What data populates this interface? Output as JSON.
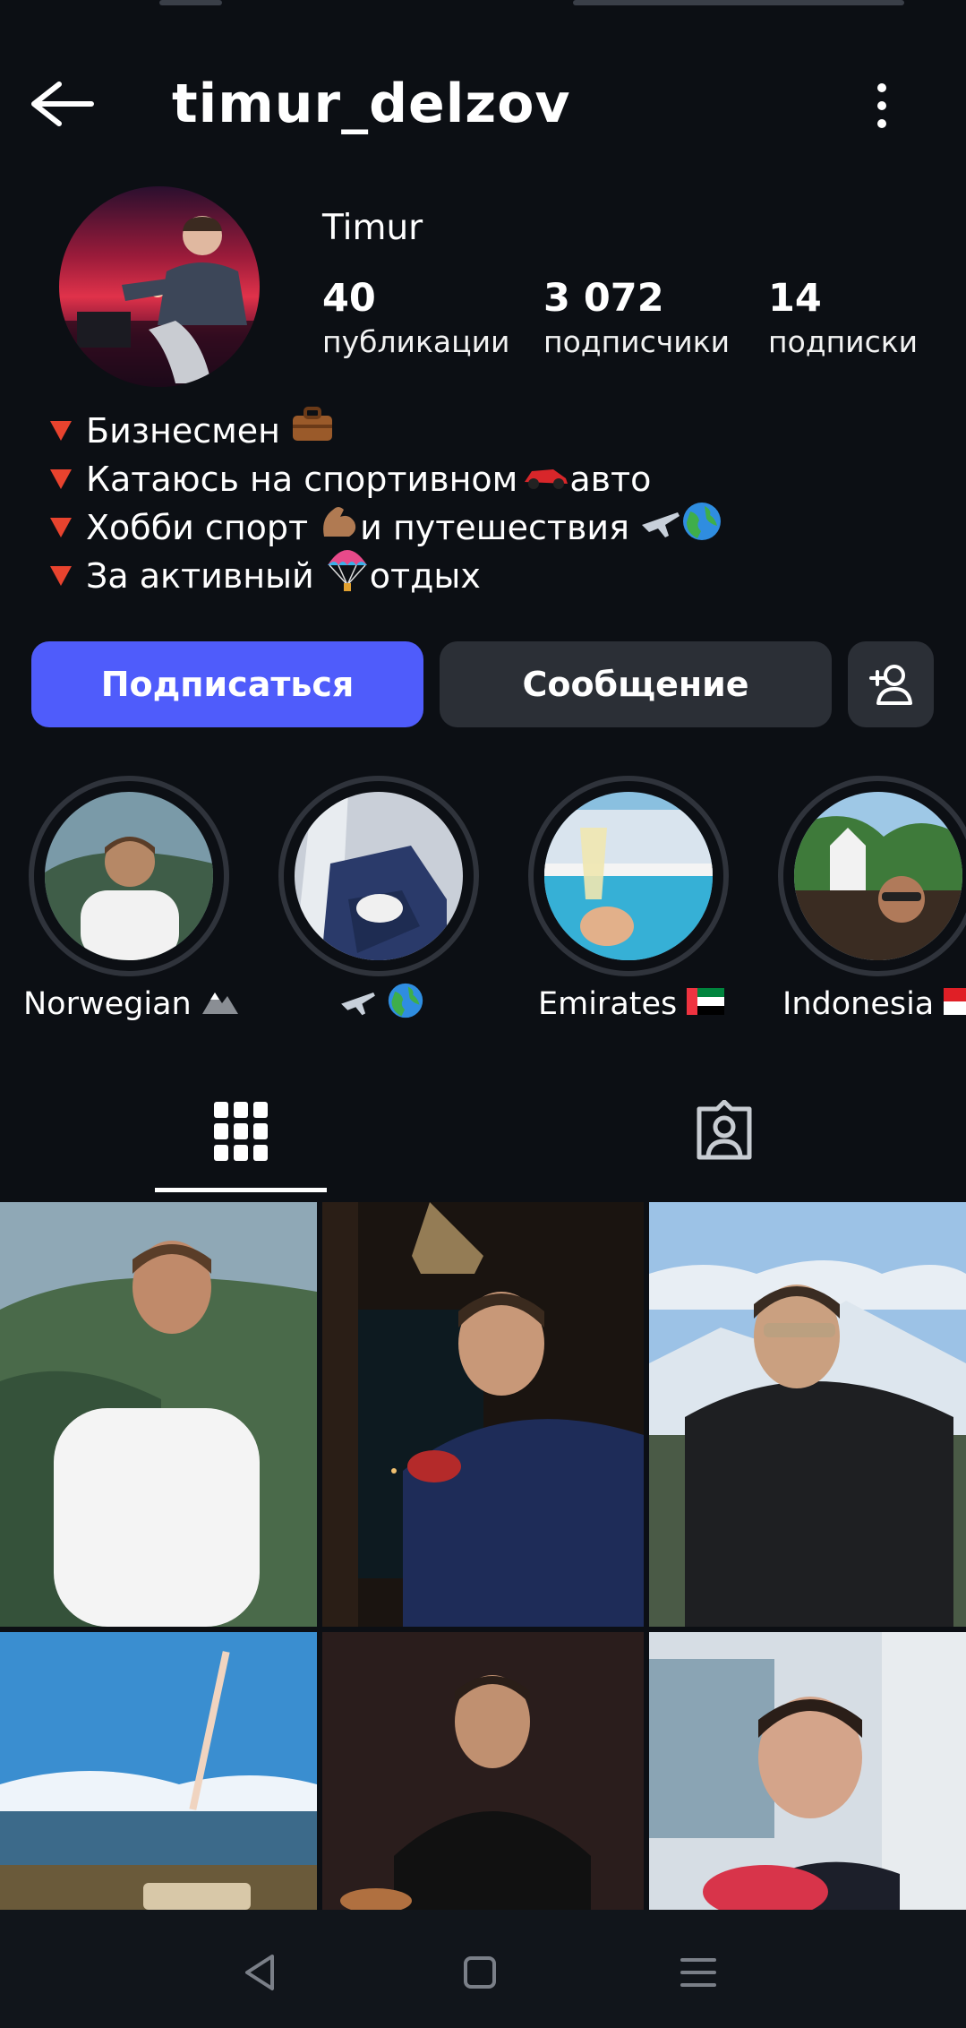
{
  "header": {
    "username": "timur_delzov"
  },
  "profile": {
    "display_name": "Timur",
    "stats": [
      {
        "value": "40",
        "label": "публикации"
      },
      {
        "value": "3 072",
        "label": "подписчики"
      },
      {
        "value": "14",
        "label": "подписки"
      }
    ],
    "bio": [
      {
        "before": "Бизнесмен",
        "emoji": "briefcase-icon",
        "after": ""
      },
      {
        "before": "Катаюсь на спортивном",
        "emoji": "race-car-icon",
        "after": " авто"
      },
      {
        "before": "Хобби спорт",
        "emoji": "flexed-biceps-icon",
        "after": " и путешествия"
      },
      {
        "before": " За активный",
        "emoji": "parachute-icon",
        "after": " отдых"
      }
    ]
  },
  "actions": {
    "follow_label": "Подписаться",
    "message_label": "Сообщение"
  },
  "highlights": [
    {
      "label": "Norwegian",
      "emoji": "mountain-icon"
    },
    {
      "label": "",
      "emoji": "airplane-globe-icon"
    },
    {
      "label": "Emirates",
      "emoji": "uae-flag-icon"
    },
    {
      "label": "Indonesia",
      "emoji": "indonesia-flag-icon"
    }
  ],
  "colors": {
    "background": "#0c0f14",
    "accent": "#4f5cfb",
    "secondary_button": "#2b2f36",
    "bio_marker": "#e8432e"
  }
}
